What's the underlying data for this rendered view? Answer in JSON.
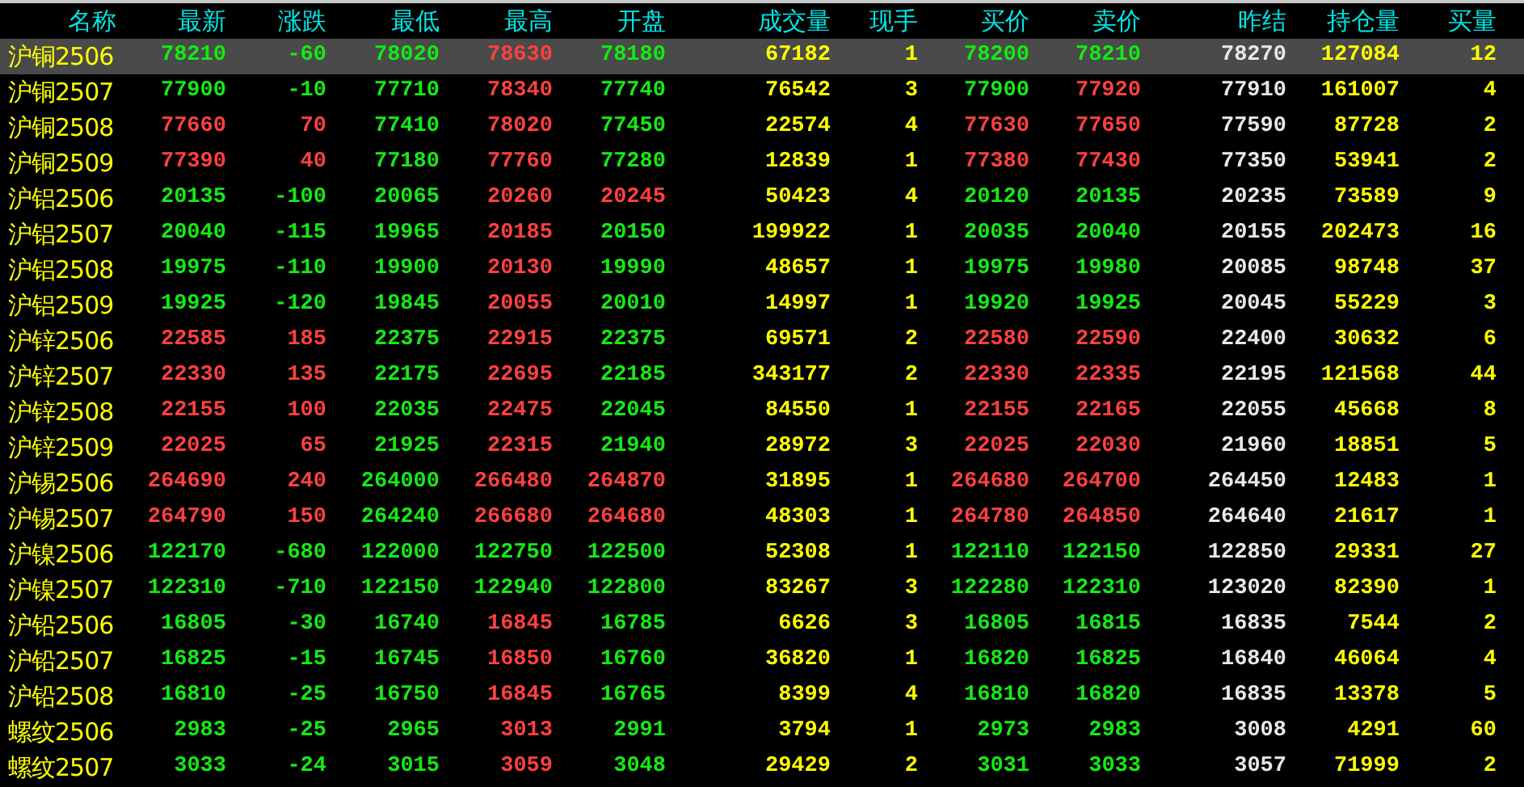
{
  "columns": [
    "名称",
    "最新",
    "涨跌",
    "最低",
    "最高",
    "开盘",
    "成交量",
    "现手",
    "买价",
    "卖价",
    "昨结",
    "持仓量",
    "买量"
  ],
  "rows": [
    {
      "name": "沪铜2506",
      "selected": true,
      "cells": [
        {
          "text": "78210",
          "kind": "down"
        },
        {
          "text": "-60",
          "kind": "down"
        },
        {
          "text": "78020",
          "kind": "down"
        },
        {
          "text": "78630",
          "kind": "up"
        },
        {
          "text": "78180",
          "kind": "down"
        },
        {
          "text": "67182",
          "kind": "vol"
        },
        {
          "text": "1",
          "kind": "vol"
        },
        {
          "text": "78200",
          "kind": "down"
        },
        {
          "text": "78210",
          "kind": "down"
        },
        {
          "text": "78270",
          "kind": "ref"
        },
        {
          "text": "127084",
          "kind": "vol"
        },
        {
          "text": "12",
          "kind": "vol"
        }
      ]
    },
    {
      "name": "沪铜2507",
      "selected": false,
      "cells": [
        {
          "text": "77900",
          "kind": "down"
        },
        {
          "text": "-10",
          "kind": "down"
        },
        {
          "text": "77710",
          "kind": "down"
        },
        {
          "text": "78340",
          "kind": "up"
        },
        {
          "text": "77740",
          "kind": "down"
        },
        {
          "text": "76542",
          "kind": "vol"
        },
        {
          "text": "3",
          "kind": "vol"
        },
        {
          "text": "77900",
          "kind": "down"
        },
        {
          "text": "77920",
          "kind": "up"
        },
        {
          "text": "77910",
          "kind": "ref"
        },
        {
          "text": "161007",
          "kind": "vol"
        },
        {
          "text": "4",
          "kind": "vol"
        }
      ]
    },
    {
      "name": "沪铜2508",
      "selected": false,
      "cells": [
        {
          "text": "77660",
          "kind": "up"
        },
        {
          "text": "70",
          "kind": "up"
        },
        {
          "text": "77410",
          "kind": "down"
        },
        {
          "text": "78020",
          "kind": "up"
        },
        {
          "text": "77450",
          "kind": "down"
        },
        {
          "text": "22574",
          "kind": "vol"
        },
        {
          "text": "4",
          "kind": "vol"
        },
        {
          "text": "77630",
          "kind": "up"
        },
        {
          "text": "77650",
          "kind": "up"
        },
        {
          "text": "77590",
          "kind": "ref"
        },
        {
          "text": "87728",
          "kind": "vol"
        },
        {
          "text": "2",
          "kind": "vol"
        }
      ]
    },
    {
      "name": "沪铜2509",
      "selected": false,
      "cells": [
        {
          "text": "77390",
          "kind": "up"
        },
        {
          "text": "40",
          "kind": "up"
        },
        {
          "text": "77180",
          "kind": "down"
        },
        {
          "text": "77760",
          "kind": "up"
        },
        {
          "text": "77280",
          "kind": "down"
        },
        {
          "text": "12839",
          "kind": "vol"
        },
        {
          "text": "1",
          "kind": "vol"
        },
        {
          "text": "77380",
          "kind": "up"
        },
        {
          "text": "77430",
          "kind": "up"
        },
        {
          "text": "77350",
          "kind": "ref"
        },
        {
          "text": "53941",
          "kind": "vol"
        },
        {
          "text": "2",
          "kind": "vol"
        }
      ]
    },
    {
      "name": "沪铝2506",
      "selected": false,
      "cells": [
        {
          "text": "20135",
          "kind": "down"
        },
        {
          "text": "-100",
          "kind": "down"
        },
        {
          "text": "20065",
          "kind": "down"
        },
        {
          "text": "20260",
          "kind": "up"
        },
        {
          "text": "20245",
          "kind": "up"
        },
        {
          "text": "50423",
          "kind": "vol"
        },
        {
          "text": "4",
          "kind": "vol"
        },
        {
          "text": "20120",
          "kind": "down"
        },
        {
          "text": "20135",
          "kind": "down"
        },
        {
          "text": "20235",
          "kind": "ref"
        },
        {
          "text": "73589",
          "kind": "vol"
        },
        {
          "text": "9",
          "kind": "vol"
        }
      ]
    },
    {
      "name": "沪铝2507",
      "selected": false,
      "cells": [
        {
          "text": "20040",
          "kind": "down"
        },
        {
          "text": "-115",
          "kind": "down"
        },
        {
          "text": "19965",
          "kind": "down"
        },
        {
          "text": "20185",
          "kind": "up"
        },
        {
          "text": "20150",
          "kind": "down"
        },
        {
          "text": "199922",
          "kind": "vol"
        },
        {
          "text": "1",
          "kind": "vol"
        },
        {
          "text": "20035",
          "kind": "down"
        },
        {
          "text": "20040",
          "kind": "down"
        },
        {
          "text": "20155",
          "kind": "ref"
        },
        {
          "text": "202473",
          "kind": "vol"
        },
        {
          "text": "16",
          "kind": "vol"
        }
      ]
    },
    {
      "name": "沪铝2508",
      "selected": false,
      "cells": [
        {
          "text": "19975",
          "kind": "down"
        },
        {
          "text": "-110",
          "kind": "down"
        },
        {
          "text": "19900",
          "kind": "down"
        },
        {
          "text": "20130",
          "kind": "up"
        },
        {
          "text": "19990",
          "kind": "down"
        },
        {
          "text": "48657",
          "kind": "vol"
        },
        {
          "text": "1",
          "kind": "vol"
        },
        {
          "text": "19975",
          "kind": "down"
        },
        {
          "text": "19980",
          "kind": "down"
        },
        {
          "text": "20085",
          "kind": "ref"
        },
        {
          "text": "98748",
          "kind": "vol"
        },
        {
          "text": "37",
          "kind": "vol"
        }
      ]
    },
    {
      "name": "沪铝2509",
      "selected": false,
      "cells": [
        {
          "text": "19925",
          "kind": "down"
        },
        {
          "text": "-120",
          "kind": "down"
        },
        {
          "text": "19845",
          "kind": "down"
        },
        {
          "text": "20055",
          "kind": "up"
        },
        {
          "text": "20010",
          "kind": "down"
        },
        {
          "text": "14997",
          "kind": "vol"
        },
        {
          "text": "1",
          "kind": "vol"
        },
        {
          "text": "19920",
          "kind": "down"
        },
        {
          "text": "19925",
          "kind": "down"
        },
        {
          "text": "20045",
          "kind": "ref"
        },
        {
          "text": "55229",
          "kind": "vol"
        },
        {
          "text": "3",
          "kind": "vol"
        }
      ]
    },
    {
      "name": "沪锌2506",
      "selected": false,
      "cells": [
        {
          "text": "22585",
          "kind": "up"
        },
        {
          "text": "185",
          "kind": "up"
        },
        {
          "text": "22375",
          "kind": "down"
        },
        {
          "text": "22915",
          "kind": "up"
        },
        {
          "text": "22375",
          "kind": "down"
        },
        {
          "text": "69571",
          "kind": "vol"
        },
        {
          "text": "2",
          "kind": "vol"
        },
        {
          "text": "22580",
          "kind": "up"
        },
        {
          "text": "22590",
          "kind": "up"
        },
        {
          "text": "22400",
          "kind": "ref"
        },
        {
          "text": "30632",
          "kind": "vol"
        },
        {
          "text": "6",
          "kind": "vol"
        }
      ]
    },
    {
      "name": "沪锌2507",
      "selected": false,
      "cells": [
        {
          "text": "22330",
          "kind": "up"
        },
        {
          "text": "135",
          "kind": "up"
        },
        {
          "text": "22175",
          "kind": "down"
        },
        {
          "text": "22695",
          "kind": "up"
        },
        {
          "text": "22185",
          "kind": "down"
        },
        {
          "text": "343177",
          "kind": "vol"
        },
        {
          "text": "2",
          "kind": "vol"
        },
        {
          "text": "22330",
          "kind": "up"
        },
        {
          "text": "22335",
          "kind": "up"
        },
        {
          "text": "22195",
          "kind": "ref"
        },
        {
          "text": "121568",
          "kind": "vol"
        },
        {
          "text": "44",
          "kind": "vol"
        }
      ]
    },
    {
      "name": "沪锌2508",
      "selected": false,
      "cells": [
        {
          "text": "22155",
          "kind": "up"
        },
        {
          "text": "100",
          "kind": "up"
        },
        {
          "text": "22035",
          "kind": "down"
        },
        {
          "text": "22475",
          "kind": "up"
        },
        {
          "text": "22045",
          "kind": "down"
        },
        {
          "text": "84550",
          "kind": "vol"
        },
        {
          "text": "1",
          "kind": "vol"
        },
        {
          "text": "22155",
          "kind": "up"
        },
        {
          "text": "22165",
          "kind": "up"
        },
        {
          "text": "22055",
          "kind": "ref"
        },
        {
          "text": "45668",
          "kind": "vol"
        },
        {
          "text": "8",
          "kind": "vol"
        }
      ]
    },
    {
      "name": "沪锌2509",
      "selected": false,
      "cells": [
        {
          "text": "22025",
          "kind": "up"
        },
        {
          "text": "65",
          "kind": "up"
        },
        {
          "text": "21925",
          "kind": "down"
        },
        {
          "text": "22315",
          "kind": "up"
        },
        {
          "text": "21940",
          "kind": "down"
        },
        {
          "text": "28972",
          "kind": "vol"
        },
        {
          "text": "3",
          "kind": "vol"
        },
        {
          "text": "22025",
          "kind": "up"
        },
        {
          "text": "22030",
          "kind": "up"
        },
        {
          "text": "21960",
          "kind": "ref"
        },
        {
          "text": "18851",
          "kind": "vol"
        },
        {
          "text": "5",
          "kind": "vol"
        }
      ]
    },
    {
      "name": "沪锡2506",
      "selected": false,
      "cells": [
        {
          "text": "264690",
          "kind": "up"
        },
        {
          "text": "240",
          "kind": "up"
        },
        {
          "text": "264000",
          "kind": "down"
        },
        {
          "text": "266480",
          "kind": "up"
        },
        {
          "text": "264870",
          "kind": "up"
        },
        {
          "text": "31895",
          "kind": "vol"
        },
        {
          "text": "1",
          "kind": "vol"
        },
        {
          "text": "264680",
          "kind": "up"
        },
        {
          "text": "264700",
          "kind": "up"
        },
        {
          "text": "264450",
          "kind": "ref"
        },
        {
          "text": "12483",
          "kind": "vol"
        },
        {
          "text": "1",
          "kind": "vol"
        }
      ]
    },
    {
      "name": "沪锡2507",
      "selected": false,
      "cells": [
        {
          "text": "264790",
          "kind": "up"
        },
        {
          "text": "150",
          "kind": "up"
        },
        {
          "text": "264240",
          "kind": "down"
        },
        {
          "text": "266680",
          "kind": "up"
        },
        {
          "text": "264680",
          "kind": "up"
        },
        {
          "text": "48303",
          "kind": "vol"
        },
        {
          "text": "1",
          "kind": "vol"
        },
        {
          "text": "264780",
          "kind": "up"
        },
        {
          "text": "264850",
          "kind": "up"
        },
        {
          "text": "264640",
          "kind": "ref"
        },
        {
          "text": "21617",
          "kind": "vol"
        },
        {
          "text": "1",
          "kind": "vol"
        }
      ]
    },
    {
      "name": "沪镍2506",
      "selected": false,
      "cells": [
        {
          "text": "122170",
          "kind": "down"
        },
        {
          "text": "-680",
          "kind": "down"
        },
        {
          "text": "122000",
          "kind": "down"
        },
        {
          "text": "122750",
          "kind": "down"
        },
        {
          "text": "122500",
          "kind": "down"
        },
        {
          "text": "52308",
          "kind": "vol"
        },
        {
          "text": "1",
          "kind": "vol"
        },
        {
          "text": "122110",
          "kind": "down"
        },
        {
          "text": "122150",
          "kind": "down"
        },
        {
          "text": "122850",
          "kind": "ref"
        },
        {
          "text": "29331",
          "kind": "vol"
        },
        {
          "text": "27",
          "kind": "vol"
        }
      ]
    },
    {
      "name": "沪镍2507",
      "selected": false,
      "cells": [
        {
          "text": "122310",
          "kind": "down"
        },
        {
          "text": "-710",
          "kind": "down"
        },
        {
          "text": "122150",
          "kind": "down"
        },
        {
          "text": "122940",
          "kind": "down"
        },
        {
          "text": "122800",
          "kind": "down"
        },
        {
          "text": "83267",
          "kind": "vol"
        },
        {
          "text": "3",
          "kind": "vol"
        },
        {
          "text": "122280",
          "kind": "down"
        },
        {
          "text": "122310",
          "kind": "down"
        },
        {
          "text": "123020",
          "kind": "ref"
        },
        {
          "text": "82390",
          "kind": "vol"
        },
        {
          "text": "1",
          "kind": "vol"
        }
      ]
    },
    {
      "name": "沪铅2506",
      "selected": false,
      "cells": [
        {
          "text": "16805",
          "kind": "down"
        },
        {
          "text": "-30",
          "kind": "down"
        },
        {
          "text": "16740",
          "kind": "down"
        },
        {
          "text": "16845",
          "kind": "up"
        },
        {
          "text": "16785",
          "kind": "down"
        },
        {
          "text": "6626",
          "kind": "vol"
        },
        {
          "text": "3",
          "kind": "vol"
        },
        {
          "text": "16805",
          "kind": "down"
        },
        {
          "text": "16815",
          "kind": "down"
        },
        {
          "text": "16835",
          "kind": "ref"
        },
        {
          "text": "7544",
          "kind": "vol"
        },
        {
          "text": "2",
          "kind": "vol"
        }
      ]
    },
    {
      "name": "沪铅2507",
      "selected": false,
      "cells": [
        {
          "text": "16825",
          "kind": "down"
        },
        {
          "text": "-15",
          "kind": "down"
        },
        {
          "text": "16745",
          "kind": "down"
        },
        {
          "text": "16850",
          "kind": "up"
        },
        {
          "text": "16760",
          "kind": "down"
        },
        {
          "text": "36820",
          "kind": "vol"
        },
        {
          "text": "1",
          "kind": "vol"
        },
        {
          "text": "16820",
          "kind": "down"
        },
        {
          "text": "16825",
          "kind": "down"
        },
        {
          "text": "16840",
          "kind": "ref"
        },
        {
          "text": "46064",
          "kind": "vol"
        },
        {
          "text": "4",
          "kind": "vol"
        }
      ]
    },
    {
      "name": "沪铅2508",
      "selected": false,
      "cells": [
        {
          "text": "16810",
          "kind": "down"
        },
        {
          "text": "-25",
          "kind": "down"
        },
        {
          "text": "16750",
          "kind": "down"
        },
        {
          "text": "16845",
          "kind": "up"
        },
        {
          "text": "16765",
          "kind": "down"
        },
        {
          "text": "8399",
          "kind": "vol"
        },
        {
          "text": "4",
          "kind": "vol"
        },
        {
          "text": "16810",
          "kind": "down"
        },
        {
          "text": "16820",
          "kind": "down"
        },
        {
          "text": "16835",
          "kind": "ref"
        },
        {
          "text": "13378",
          "kind": "vol"
        },
        {
          "text": "5",
          "kind": "vol"
        }
      ]
    },
    {
      "name": "螺纹2506",
      "selected": false,
      "cells": [
        {
          "text": "2983",
          "kind": "down"
        },
        {
          "text": "-25",
          "kind": "down"
        },
        {
          "text": "2965",
          "kind": "down"
        },
        {
          "text": "3013",
          "kind": "up"
        },
        {
          "text": "2991",
          "kind": "down"
        },
        {
          "text": "3794",
          "kind": "vol"
        },
        {
          "text": "1",
          "kind": "vol"
        },
        {
          "text": "2973",
          "kind": "down"
        },
        {
          "text": "2983",
          "kind": "down"
        },
        {
          "text": "3008",
          "kind": "ref"
        },
        {
          "text": "4291",
          "kind": "vol"
        },
        {
          "text": "60",
          "kind": "vol"
        }
      ]
    },
    {
      "name": "螺纹2507",
      "selected": false,
      "cells": [
        {
          "text": "3033",
          "kind": "down"
        },
        {
          "text": "-24",
          "kind": "down"
        },
        {
          "text": "3015",
          "kind": "down"
        },
        {
          "text": "3059",
          "kind": "up"
        },
        {
          "text": "3048",
          "kind": "down"
        },
        {
          "text": "29429",
          "kind": "vol"
        },
        {
          "text": "2",
          "kind": "vol"
        },
        {
          "text": "3031",
          "kind": "down"
        },
        {
          "text": "3033",
          "kind": "down"
        },
        {
          "text": "3057",
          "kind": "ref"
        },
        {
          "text": "71999",
          "kind": "vol"
        },
        {
          "text": "2",
          "kind": "vol"
        }
      ]
    }
  ]
}
